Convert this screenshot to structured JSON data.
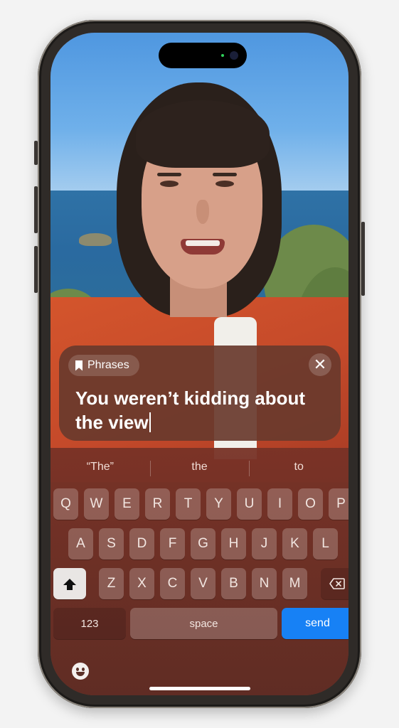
{
  "phrase_panel": {
    "phrases_label": "Phrases",
    "close_label": "✕",
    "text": "You weren’t kidding about the view"
  },
  "keyboard": {
    "suggestions": [
      "“The”",
      "the",
      "to"
    ],
    "row1": [
      "Q",
      "W",
      "E",
      "R",
      "T",
      "Y",
      "U",
      "I",
      "O",
      "P"
    ],
    "row2": [
      "A",
      "S",
      "D",
      "F",
      "G",
      "H",
      "J",
      "K",
      "L"
    ],
    "row3": [
      "Z",
      "X",
      "C",
      "V",
      "B",
      "N",
      "M"
    ],
    "numbers_label": "123",
    "space_label": "space",
    "send_label": "send"
  },
  "colors": {
    "send": "#1781f5",
    "panel": "#693a2c",
    "keyboard": "#6f2f26"
  }
}
